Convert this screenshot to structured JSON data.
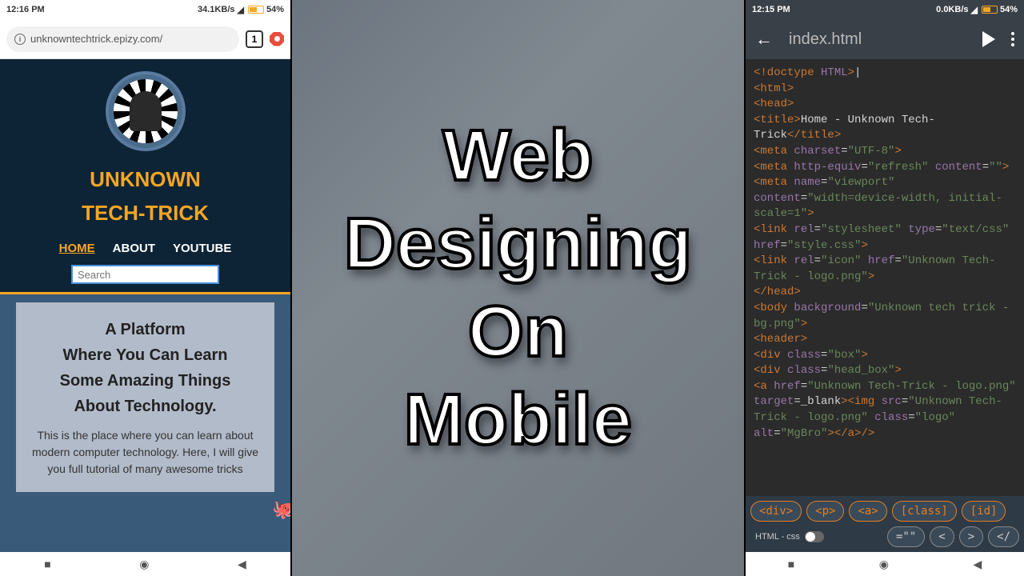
{
  "left_phone": {
    "status": {
      "time": "12:16 PM",
      "speed": "34.1KB/s",
      "battery": "54%"
    },
    "url": "unknowntechtrick.epizy.com/",
    "tab_count": "1",
    "site_title_1": "UNKNOWN",
    "site_title_2": "TECH-TRICK",
    "nav": {
      "home": "HOME",
      "about": "ABOUT",
      "youtube": "YOUTUBE"
    },
    "search_placeholder": "Search",
    "headline_1": "A Platform",
    "headline_2": "Where You Can Learn",
    "headline_3": "Some Amazing Things",
    "headline_4": "About Technology.",
    "body_text": "This is the place where you can learn about modern computer technology. Here, I will give you full tutorial of many awesome tricks"
  },
  "center": {
    "l1": "Web",
    "l2": "Designing",
    "l3": "On",
    "l4": "Mobile"
  },
  "right_phone": {
    "status": {
      "time": "12:15 PM",
      "speed": "0.0KB/s",
      "battery": "54%"
    },
    "filename": "index.html",
    "snippets": [
      "<div>",
      "<p>",
      "<a>",
      "[class]",
      "[id]"
    ],
    "toggle_label": "HTML - css",
    "snippets2": [
      "=\"\"",
      "<",
      ">",
      "</"
    ],
    "code_lines": [
      {
        "parts": [
          {
            "c": "t",
            "t": "<!doctype "
          },
          {
            "c": "a",
            "t": "HTML"
          },
          {
            "c": "t",
            "t": ">"
          },
          {
            "c": "w",
            "t": "|"
          }
        ]
      },
      {
        "parts": [
          {
            "c": "t",
            "t": "<html>"
          }
        ]
      },
      {
        "parts": [
          {
            "c": "t",
            "t": "<head>"
          }
        ]
      },
      {
        "parts": [
          {
            "c": "t",
            "t": "<title>"
          },
          {
            "c": "w",
            "t": "Home - Unknown Tech-Trick"
          },
          {
            "c": "t",
            "t": "</title>"
          }
        ]
      },
      {
        "parts": [
          {
            "c": "t",
            "t": "<meta "
          },
          {
            "c": "a",
            "t": "charset"
          },
          {
            "c": "w",
            "t": "="
          },
          {
            "c": "s",
            "t": "\"UTF-8\""
          },
          {
            "c": "t",
            "t": ">"
          }
        ]
      },
      {
        "parts": [
          {
            "c": "t",
            "t": "<meta "
          },
          {
            "c": "a",
            "t": "http-equiv"
          },
          {
            "c": "w",
            "t": "="
          },
          {
            "c": "s",
            "t": "\"refresh\""
          },
          {
            "c": "w",
            "t": " "
          },
          {
            "c": "a",
            "t": "content"
          },
          {
            "c": "w",
            "t": "="
          },
          {
            "c": "s",
            "t": "\"\""
          },
          {
            "c": "t",
            "t": ">"
          }
        ]
      },
      {
        "parts": [
          {
            "c": "t",
            "t": "<meta "
          },
          {
            "c": "a",
            "t": "name"
          },
          {
            "c": "w",
            "t": "="
          },
          {
            "c": "s",
            "t": "\"viewport\""
          },
          {
            "c": "w",
            "t": " "
          },
          {
            "c": "a",
            "t": "content"
          },
          {
            "c": "w",
            "t": "="
          },
          {
            "c": "s",
            "t": "\"width=device-width, initial-scale=1\""
          },
          {
            "c": "t",
            "t": ">"
          }
        ]
      },
      {
        "parts": [
          {
            "c": "w",
            "t": " "
          }
        ]
      },
      {
        "parts": [
          {
            "c": "t",
            "t": "<link "
          },
          {
            "c": "a",
            "t": "rel"
          },
          {
            "c": "w",
            "t": "="
          },
          {
            "c": "s",
            "t": "\"stylesheet\""
          },
          {
            "c": "w",
            "t": " "
          },
          {
            "c": "a",
            "t": "type"
          },
          {
            "c": "w",
            "t": "="
          },
          {
            "c": "s",
            "t": "\"text/css\""
          },
          {
            "c": "w",
            "t": " "
          },
          {
            "c": "a",
            "t": "href"
          },
          {
            "c": "w",
            "t": "="
          },
          {
            "c": "s",
            "t": "\"style.css\""
          },
          {
            "c": "t",
            "t": ">"
          }
        ]
      },
      {
        "parts": [
          {
            "c": "t",
            "t": "<link "
          },
          {
            "c": "a",
            "t": "rel"
          },
          {
            "c": "w",
            "t": "="
          },
          {
            "c": "s",
            "t": "\"icon\""
          },
          {
            "c": "w",
            "t": " "
          },
          {
            "c": "a",
            "t": "href"
          },
          {
            "c": "w",
            "t": "="
          },
          {
            "c": "s",
            "t": "\"Unknown Tech-Trick - logo.png\""
          },
          {
            "c": "t",
            "t": ">"
          }
        ]
      },
      {
        "parts": [
          {
            "c": "t",
            "t": "</head>"
          }
        ]
      },
      {
        "parts": [
          {
            "c": "t",
            "t": "<body "
          },
          {
            "c": "a",
            "t": "background"
          },
          {
            "c": "w",
            "t": "="
          },
          {
            "c": "s",
            "t": "\"Unknown tech trick - bg.png\""
          },
          {
            "c": "t",
            "t": ">"
          }
        ]
      },
      {
        "parts": [
          {
            "c": "w",
            "t": " "
          }
        ]
      },
      {
        "parts": [
          {
            "c": "t",
            "t": "<header>"
          }
        ]
      },
      {
        "parts": [
          {
            "c": "t",
            "t": "<div "
          },
          {
            "c": "a",
            "t": "class"
          },
          {
            "c": "w",
            "t": "="
          },
          {
            "c": "s",
            "t": "\"box\""
          },
          {
            "c": "t",
            "t": ">"
          }
        ]
      },
      {
        "parts": [
          {
            "c": "t",
            "t": "<div "
          },
          {
            "c": "a",
            "t": "class"
          },
          {
            "c": "w",
            "t": "="
          },
          {
            "c": "s",
            "t": "\"head_box\""
          },
          {
            "c": "t",
            "t": ">"
          }
        ]
      },
      {
        "parts": [
          {
            "c": "t",
            "t": "<a "
          },
          {
            "c": "a",
            "t": "href"
          },
          {
            "c": "w",
            "t": "="
          },
          {
            "c": "s",
            "t": "\"Unknown Tech-Trick - logo.png\""
          },
          {
            "c": "w",
            "t": " "
          },
          {
            "c": "a",
            "t": "target"
          },
          {
            "c": "w",
            "t": "=_blank"
          },
          {
            "c": "t",
            "t": "><img "
          },
          {
            "c": "a",
            "t": "src"
          },
          {
            "c": "w",
            "t": "="
          },
          {
            "c": "s",
            "t": "\"Unknown Tech-Trick - logo.png\""
          },
          {
            "c": "w",
            "t": " "
          },
          {
            "c": "a",
            "t": "class"
          },
          {
            "c": "w",
            "t": "="
          },
          {
            "c": "s",
            "t": "\"logo\""
          },
          {
            "c": "w",
            "t": " "
          },
          {
            "c": "a",
            "t": "alt"
          },
          {
            "c": "w",
            "t": "="
          },
          {
            "c": "s",
            "t": "\"MgBro\""
          },
          {
            "c": "t",
            "t": "></a>/>"
          }
        ]
      }
    ]
  }
}
